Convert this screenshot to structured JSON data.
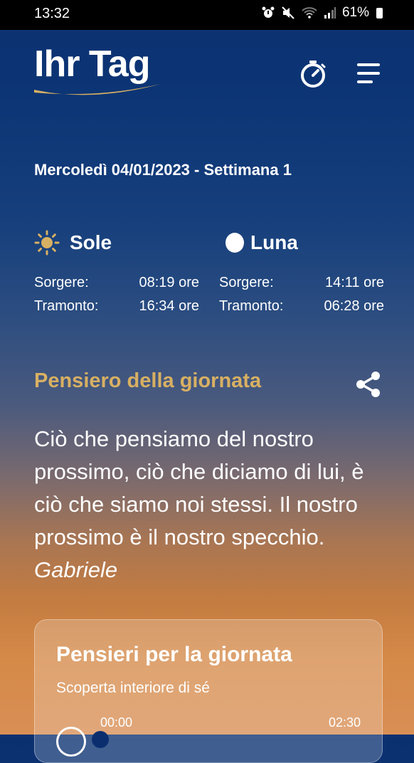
{
  "status_bar": {
    "time": "13:32",
    "battery": "61%",
    "icons": [
      "alarm-icon",
      "mute-icon",
      "wifi-icon",
      "signal-icon",
      "battery-icon"
    ]
  },
  "app": {
    "logo_text": "Ihr Tag",
    "icons": {
      "timer": "timer-icon",
      "menu": "menu-icon",
      "share": "share-icon"
    },
    "colors": {
      "accent_gold": "#d8b063",
      "background_top": "#0b3070",
      "background_bottom": "#d98f55"
    }
  },
  "date_line": "Mercoledì 04/01/2023 - Settimana 1",
  "sun": {
    "title": "Sole",
    "rise_label": "Sorgere:",
    "rise_time": "08:19 ore",
    "set_label": "Tramonto:",
    "set_time": "16:34 ore"
  },
  "moon": {
    "title": "Luna",
    "rise_label": "Sorgere:",
    "rise_time": "14:11 ore",
    "set_label": "Tramonto:",
    "set_time": "06:28 ore"
  },
  "thought": {
    "title": "Pensiero della giornata",
    "text": "Ciò che pensiamo del nostro prossimo, ciò che diciamo di lui, è ciò che siamo noi stessi. Il nostro prossimo è il nostro specchio.",
    "author": "Gabriele"
  },
  "audio_card": {
    "title": "Pensieri per la giornata",
    "subtitle": "Scoperta interiore di sé",
    "time_current": "00:00",
    "time_total": "02:30"
  }
}
